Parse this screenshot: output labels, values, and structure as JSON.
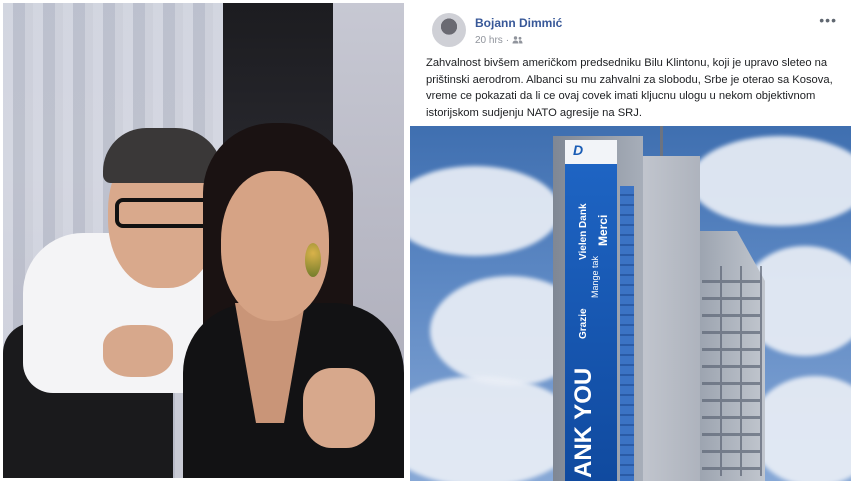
{
  "post": {
    "author": "Bojann Dimmić",
    "time": "20 hrs",
    "separator": "·",
    "more": "•••",
    "text": "Zahvalnost bivšem američkom predsedniku Bilu Klintonu, koji je upravo sleteo na prištinski aerodrom. Albanci su mu zahvalni za slobodu, Srbe je oterao sa Kosova, vreme ce pokazati da li ce ovaj covek imati kljucnu ulogu u nekom objektivnom istorijskom sudjenju NATO agresije na SRJ.",
    "icons": {
      "privacy": "friends-icon",
      "avatar": "profile-avatar",
      "menu": "more-options-icon"
    }
  },
  "banner": {
    "logo": "D",
    "phrases": [
      "Vielen Dank",
      "Merci",
      "Mange tak",
      "Grazie",
      "ANK YOU"
    ]
  },
  "colors": {
    "author_link": "#385898",
    "banner_blue": "#1e64c3",
    "meta_gray": "#90949c"
  }
}
